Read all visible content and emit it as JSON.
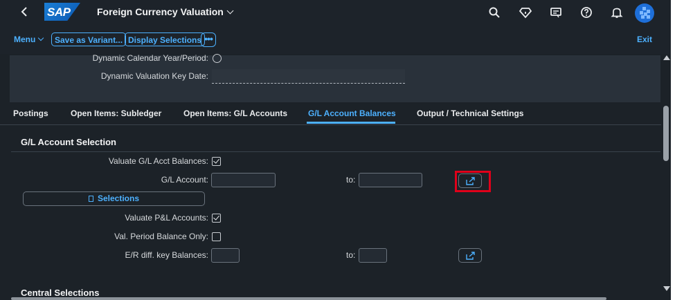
{
  "shell": {
    "logo_text": "SAP",
    "title": "Foreign Currency Valuation",
    "icons": [
      "back-icon",
      "search-icon",
      "diamond-icon",
      "feedback-icon",
      "help-icon",
      "bell-icon",
      "avatar"
    ]
  },
  "toolbar": {
    "menu_label": "Menu",
    "save_variant_label": "Save as Variant...",
    "display_selections_label": "Display Selections",
    "more_label": "•••",
    "exit_label": "Exit"
  },
  "top_panel": {
    "dynamic_calendar_label": "Dynamic Calendar Year/Period:",
    "dynamic_valuation_label": "Dynamic Valuation Key Date:",
    "dynamic_valuation_value": ""
  },
  "tabs": [
    {
      "label": "Postings",
      "active": false
    },
    {
      "label": "Open Items: Subledger",
      "active": false
    },
    {
      "label": "Open Items: G/L Accounts",
      "active": false
    },
    {
      "label": "G/L Account Balances",
      "active": true
    },
    {
      "label": "Output / Technical Settings",
      "active": false
    }
  ],
  "gl_section": {
    "title": "G/L Account Selection",
    "valuate_gl_label": "Valuate G/L Acct Balances:",
    "valuate_gl_checked": true,
    "gl_account_label": "G/L Account:",
    "gl_account_from": "",
    "to_label": "to:",
    "gl_account_to": "",
    "selections_label": "Selections",
    "valuate_pl_label": "Valuate P&L Accounts:",
    "valuate_pl_checked": true,
    "val_period_label": "Val. Period Balance Only:",
    "val_period_checked": false,
    "er_diff_label": "E/R diff. key Balances:",
    "er_diff_from": "",
    "er_to_label": "to:",
    "er_diff_to": ""
  },
  "central_section": {
    "title": "Central Selections"
  },
  "colors": {
    "accent": "#4db1ff",
    "background": "#1c2228",
    "highlight": "#e0001a"
  }
}
